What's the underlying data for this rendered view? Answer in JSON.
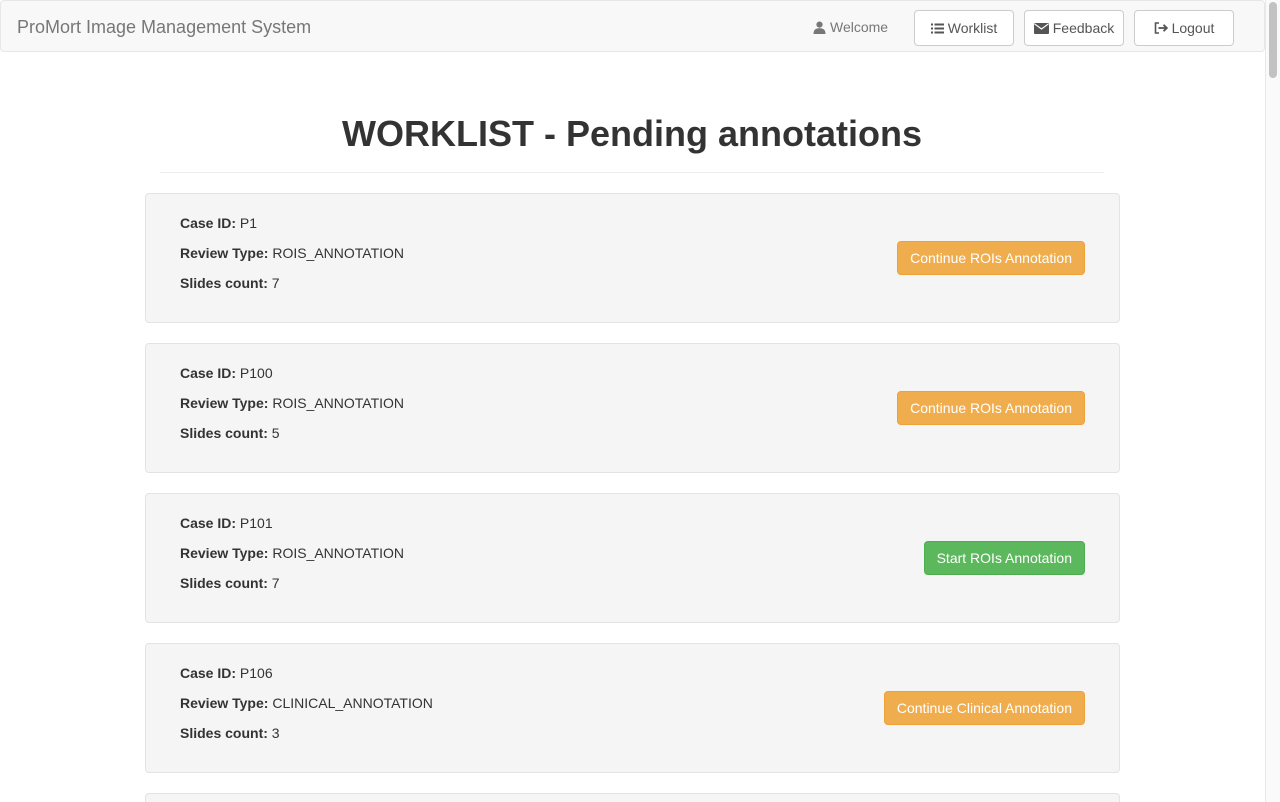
{
  "navbar": {
    "brand": "ProMort Image Management System",
    "welcome": "Welcome",
    "worklist": "Worklist",
    "feedback": "Feedback",
    "logout": "Logout"
  },
  "main": {
    "title": "WORKLIST - Pending annotations"
  },
  "labels": {
    "case_id": "Case ID:",
    "review_type": "Review Type:",
    "slides_count": "Slides count:"
  },
  "cases": [
    {
      "case_id": "P1",
      "review_type": "ROIS_ANNOTATION",
      "slides_count": "7",
      "action": "Continue ROIs Annotation",
      "status": "continue"
    },
    {
      "case_id": "P100",
      "review_type": "ROIS_ANNOTATION",
      "slides_count": "5",
      "action": "Continue ROIs Annotation",
      "status": "continue"
    },
    {
      "case_id": "P101",
      "review_type": "ROIS_ANNOTATION",
      "slides_count": "7",
      "action": "Start ROIs Annotation",
      "status": "start"
    },
    {
      "case_id": "P106",
      "review_type": "CLINICAL_ANNOTATION",
      "slides_count": "3",
      "action": "Continue Clinical Annotation",
      "status": "continue"
    }
  ],
  "colors": {
    "continue": "#f0ad4e",
    "start": "#5cb85c",
    "card_bg": "#f5f5f5"
  },
  "icons": {
    "welcome": "user-icon",
    "worklist": "list-icon",
    "feedback": "envelope-icon",
    "logout": "logout-icon"
  }
}
